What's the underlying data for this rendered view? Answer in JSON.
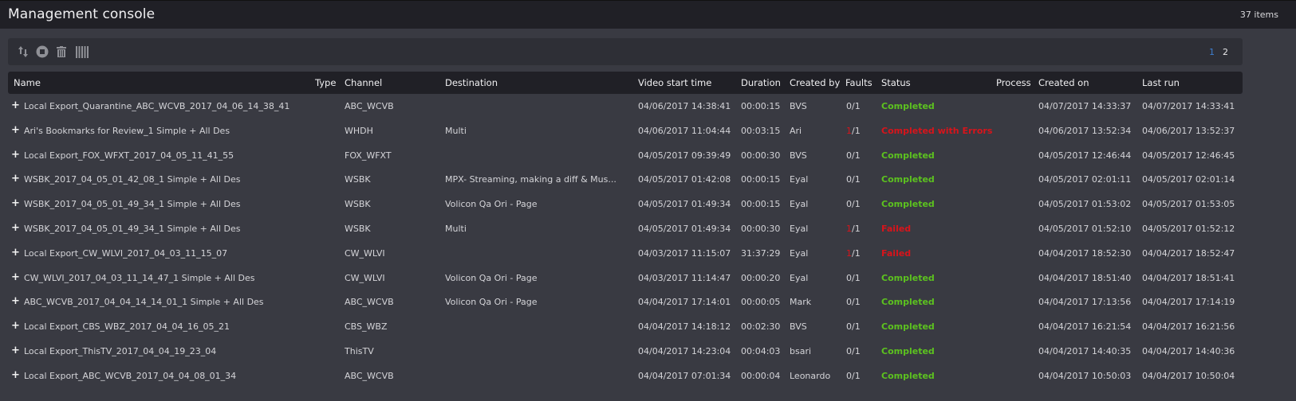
{
  "header": {
    "title": "Management console",
    "item_count": "37 items"
  },
  "toolbar": {
    "icons": [
      "sort-arrows-icon",
      "stop-icon",
      "trash-icon",
      "columns-icon"
    ],
    "pages": [
      "1",
      "2"
    ],
    "active_page": "1"
  },
  "colors": {
    "completed": "#5cc21f",
    "error": "#d8141b",
    "active_page": "#3e7fd1"
  },
  "columns": {
    "name": "Name",
    "type": "Type",
    "channel": "Channel",
    "destination": "Destination",
    "video_start": "Video start time",
    "duration": "Duration",
    "created_by": "Created by",
    "faults": "Faults",
    "status": "Status",
    "process": "Process",
    "created_on": "Created on",
    "last_run": "Last run"
  },
  "rows": [
    {
      "name": "Local Export_Quarantine_ABC_WCVB_2017_04_06_14_38_41",
      "type": "",
      "channel": "ABC_WCVB",
      "destination": "",
      "video_start": "04/06/2017 14:38:41",
      "duration": "00:00:15",
      "created_by": "BVS",
      "faults_num": "0",
      "faults_den": "/1",
      "status": "Completed",
      "status_kind": "ok",
      "process": "",
      "created_on": "04/07/2017 14:33:37",
      "last_run": "04/07/2017 14:33:41"
    },
    {
      "name": "Ari's Bookmarks for Review_1 Simple + All Des",
      "type": "",
      "channel": "WHDH",
      "destination": "Multi",
      "video_start": "04/06/2017 11:04:44",
      "duration": "00:03:15",
      "created_by": "Ari",
      "faults_num": "1",
      "faults_den": "/1",
      "status": "Completed with Errors",
      "status_kind": "err",
      "process": "",
      "created_on": "04/06/2017 13:52:34",
      "last_run": "04/06/2017 13:52:37"
    },
    {
      "name": "Local Export_FOX_WFXT_2017_04_05_11_41_55",
      "type": "",
      "channel": "FOX_WFXT",
      "destination": "",
      "video_start": "04/05/2017 09:39:49",
      "duration": "00:00:30",
      "created_by": "BVS",
      "faults_num": "0",
      "faults_den": "/1",
      "status": "Completed",
      "status_kind": "ok",
      "process": "",
      "created_on": "04/05/2017 12:46:44",
      "last_run": "04/05/2017 12:46:45"
    },
    {
      "name": "WSBK_2017_04_05_01_42_08_1 Simple + All Des",
      "type": "",
      "channel": "WSBK",
      "destination": "MPX- Streaming, making a diff & Mus...",
      "video_start": "04/05/2017 01:42:08",
      "duration": "00:00:15",
      "created_by": "Eyal",
      "faults_num": "0",
      "faults_den": "/1",
      "status": "Completed",
      "status_kind": "ok",
      "process": "",
      "created_on": "04/05/2017 02:01:11",
      "last_run": "04/05/2017 02:01:14"
    },
    {
      "name": "WSBK_2017_04_05_01_49_34_1 Simple + All Des",
      "type": "",
      "channel": "WSBK",
      "destination": "Volicon Qa Ori - Page",
      "video_start": "04/05/2017 01:49:34",
      "duration": "00:00:15",
      "created_by": "Eyal",
      "faults_num": "0",
      "faults_den": "/1",
      "status": "Completed",
      "status_kind": "ok",
      "process": "",
      "created_on": "04/05/2017 01:53:02",
      "last_run": "04/05/2017 01:53:05"
    },
    {
      "name": "WSBK_2017_04_05_01_49_34_1 Simple + All Des",
      "type": "",
      "channel": "WSBK",
      "destination": "Multi",
      "video_start": "04/05/2017 01:49:34",
      "duration": "00:00:30",
      "created_by": "Eyal",
      "faults_num": "1",
      "faults_den": "/1",
      "status": "Failed",
      "status_kind": "err",
      "process": "",
      "created_on": "04/05/2017 01:52:10",
      "last_run": "04/05/2017 01:52:12"
    },
    {
      "name": "Local Export_CW_WLVI_2017_04_03_11_15_07",
      "type": "",
      "channel": "CW_WLVI",
      "destination": "",
      "video_start": "04/03/2017 11:15:07",
      "duration": "31:37:29",
      "created_by": "Eyal",
      "faults_num": "1",
      "faults_den": "/1",
      "status": "Failed",
      "status_kind": "err",
      "process": "",
      "created_on": "04/04/2017 18:52:30",
      "last_run": "04/04/2017 18:52:47"
    },
    {
      "name": "CW_WLVI_2017_04_03_11_14_47_1 Simple + All Des",
      "type": "",
      "channel": "CW_WLVI",
      "destination": "Volicon Qa Ori - Page",
      "video_start": "04/03/2017 11:14:47",
      "duration": "00:00:20",
      "created_by": "Eyal",
      "faults_num": "0",
      "faults_den": "/1",
      "status": "Completed",
      "status_kind": "ok",
      "process": "",
      "created_on": "04/04/2017 18:51:40",
      "last_run": "04/04/2017 18:51:41"
    },
    {
      "name": "ABC_WCVB_2017_04_04_14_14_01_1 Simple + All Des",
      "type": "",
      "channel": "ABC_WCVB",
      "destination": "Volicon Qa Ori - Page",
      "video_start": "04/04/2017 17:14:01",
      "duration": "00:00:05",
      "created_by": "Mark",
      "faults_num": "0",
      "faults_den": "/1",
      "status": "Completed",
      "status_kind": "ok",
      "process": "",
      "created_on": "04/04/2017 17:13:56",
      "last_run": "04/04/2017 17:14:19"
    },
    {
      "name": "Local Export_CBS_WBZ_2017_04_04_16_05_21",
      "type": "",
      "channel": "CBS_WBZ",
      "destination": "",
      "video_start": "04/04/2017 14:18:12",
      "duration": "00:02:30",
      "created_by": "BVS",
      "faults_num": "0",
      "faults_den": "/1",
      "status": "Completed",
      "status_kind": "ok",
      "process": "",
      "created_on": "04/04/2017 16:21:54",
      "last_run": "04/04/2017 16:21:56"
    },
    {
      "name": "Local Export_ThisTV_2017_04_04_19_23_04",
      "type": "",
      "channel": "ThisTV",
      "destination": "",
      "video_start": "04/04/2017 14:23:04",
      "duration": "00:04:03",
      "created_by": "bsari",
      "faults_num": "0",
      "faults_den": "/1",
      "status": "Completed",
      "status_kind": "ok",
      "process": "",
      "created_on": "04/04/2017 14:40:35",
      "last_run": "04/04/2017 14:40:36"
    },
    {
      "name": "Local Export_ABC_WCVB_2017_04_04_08_01_34",
      "type": "",
      "channel": "ABC_WCVB",
      "destination": "",
      "video_start": "04/04/2017 07:01:34",
      "duration": "00:00:04",
      "created_by": "Leonardo",
      "faults_num": "0",
      "faults_den": "/1",
      "status": "Completed",
      "status_kind": "ok",
      "process": "",
      "created_on": "04/04/2017 10:50:03",
      "last_run": "04/04/2017 10:50:04"
    }
  ]
}
